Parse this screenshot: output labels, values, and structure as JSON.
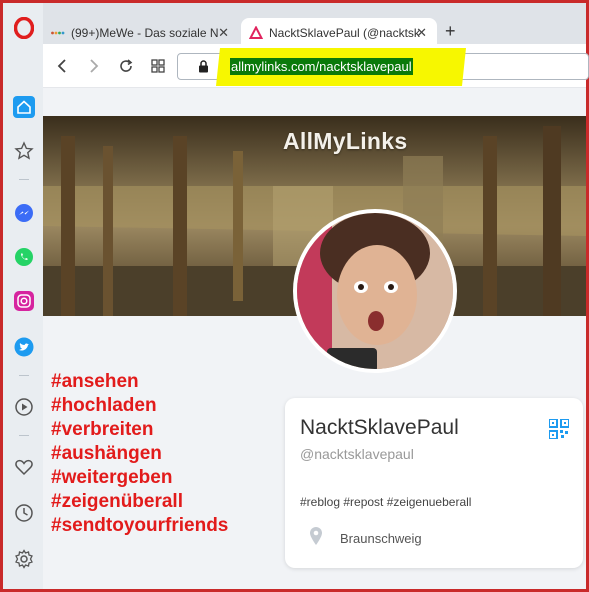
{
  "browser": {
    "tabs": [
      {
        "title": "(99+)MeWe - Das soziale N",
        "active": false
      },
      {
        "title": "NacktSklavePaul (@nacktsk",
        "active": true
      }
    ],
    "new_tab_label": "+",
    "url": "allmylinks.com/nacktsklavepaul"
  },
  "sidebar": {
    "icons": [
      "opera-logo",
      "home-icon",
      "star-icon",
      "messenger-icon",
      "whatsapp-icon",
      "instagram-icon",
      "twitter-icon",
      "player-icon",
      "heart-icon",
      "history-icon",
      "settings-icon"
    ]
  },
  "page": {
    "brand": "AllMyLinks",
    "hashtags": [
      "#ansehen",
      "#hochladen",
      "#verbreiten",
      "#aushängen",
      "#weitergeben",
      "#zeigenüberall",
      "#sendtoyourfriends"
    ],
    "profile": {
      "name": "NacktSklavePaul",
      "handle": "@nacktsklavepaul",
      "tags": "#reblog #repost #zeigenueberall",
      "location": "Braunschweig"
    }
  },
  "colors": {
    "frame": "#c92a2a",
    "hashtag": "#e21b1b",
    "url_highlight": "#f7f700",
    "url_selection": "#0a7a0a"
  }
}
